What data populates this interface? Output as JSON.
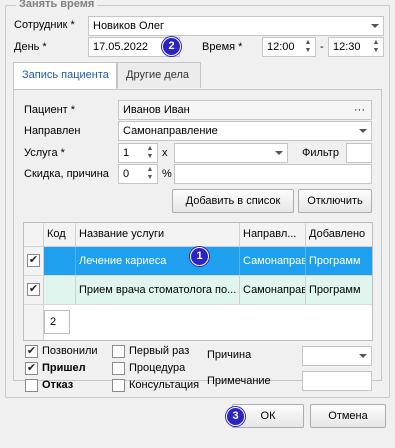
{
  "group_title": "Занять время",
  "employee": {
    "label": "Сотрудник *",
    "value": "Новиков Олег"
  },
  "day": {
    "label": "День *",
    "value": "17.05.2022"
  },
  "time": {
    "label": "Время *",
    "from": "12:00",
    "separator": "-",
    "to": "12:30"
  },
  "tabs": [
    {
      "label": "Запись пациента",
      "active": true
    },
    {
      "label": "Другие дела",
      "active": false
    }
  ],
  "patient": {
    "label": "Пациент *",
    "value": "Иванов Иван",
    "button": "···"
  },
  "referred": {
    "label": "Направлен",
    "value": "Самонаправление"
  },
  "service": {
    "label": "Услуга *",
    "qty": "1",
    "x_label": "x",
    "filter_label": "Фильтр"
  },
  "discount": {
    "label": "Скидка, причина",
    "value": "0",
    "percent": "%"
  },
  "buttons": {
    "add_to_list": "Добавить в список",
    "disable": "Отключить",
    "ok": "ОК",
    "cancel": "Отмена"
  },
  "grid": {
    "columns": [
      "Код",
      "Название услуги",
      "Направл...",
      "Добавлено"
    ],
    "rows": [
      {
        "checked": true,
        "selected": true,
        "code": "",
        "name": "Лечение кариеса",
        "direction": "Самонаправ",
        "added": "Программ"
      },
      {
        "checked": true,
        "selected": false,
        "code": "",
        "name": "Прием врача стоматолога по...",
        "direction": "Самонаправ",
        "added": "Программ"
      }
    ],
    "footer_count": "2"
  },
  "checks": {
    "called": {
      "label": "Позвонили",
      "checked": true
    },
    "came": {
      "label": "Пришел",
      "checked": true
    },
    "refusal": {
      "label": "Отказ",
      "checked": false
    },
    "first_time": {
      "label": "Первый раз",
      "checked": false
    },
    "procedure": {
      "label": "Процедура",
      "checked": false
    },
    "consultation": {
      "label": "Консультация",
      "checked": false
    }
  },
  "reason": {
    "label": "Причина",
    "value": ""
  },
  "note": {
    "label": "Примечание",
    "value": ""
  },
  "badges": {
    "one": "1",
    "two": "2",
    "three": "3"
  },
  "colors": {
    "selected_row": "#1ea0ee",
    "second_row": "#dff5ee",
    "badge": "#2b24c4",
    "active_tab_text": "#1e5aa8"
  }
}
